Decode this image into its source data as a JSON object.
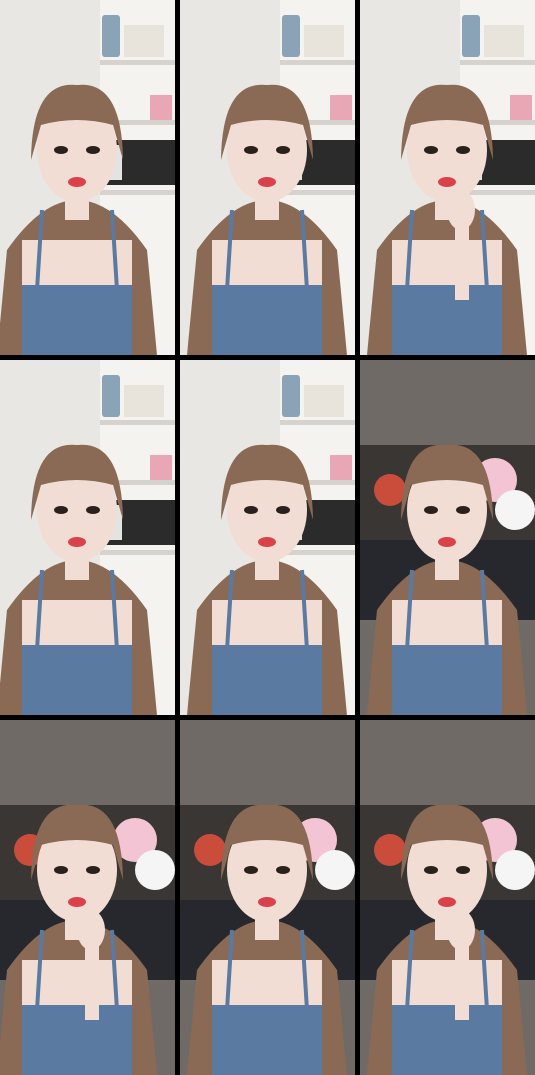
{
  "collage": {
    "rows": 3,
    "columns": 3,
    "tiles": [
      {
        "scene": "kitchen-shelves",
        "pose": "close-up"
      },
      {
        "scene": "kitchen-shelves",
        "pose": "speaking"
      },
      {
        "scene": "kitchen-shelves",
        "pose": "hand-to-chin"
      },
      {
        "scene": "kitchen-shelves",
        "pose": "speaking"
      },
      {
        "scene": "kitchen-shelves",
        "pose": "speaking"
      },
      {
        "scene": "bedroom-plush-toys",
        "pose": "speaking"
      },
      {
        "scene": "bedroom-plush-toys",
        "pose": "hand-to-chin"
      },
      {
        "scene": "bedroom-plush-toys",
        "pose": "speaking"
      },
      {
        "scene": "bedroom-plush-toys",
        "pose": "hand-to-chin"
      }
    ]
  },
  "colors": {
    "background": "#000000",
    "wall_light": "#e9e7e3",
    "wall_dark": "#6f6a66",
    "hair": "#8a6a55",
    "skin": "#f1ddd3",
    "denim": "#5a7aa2",
    "lips": "#d9424a"
  }
}
